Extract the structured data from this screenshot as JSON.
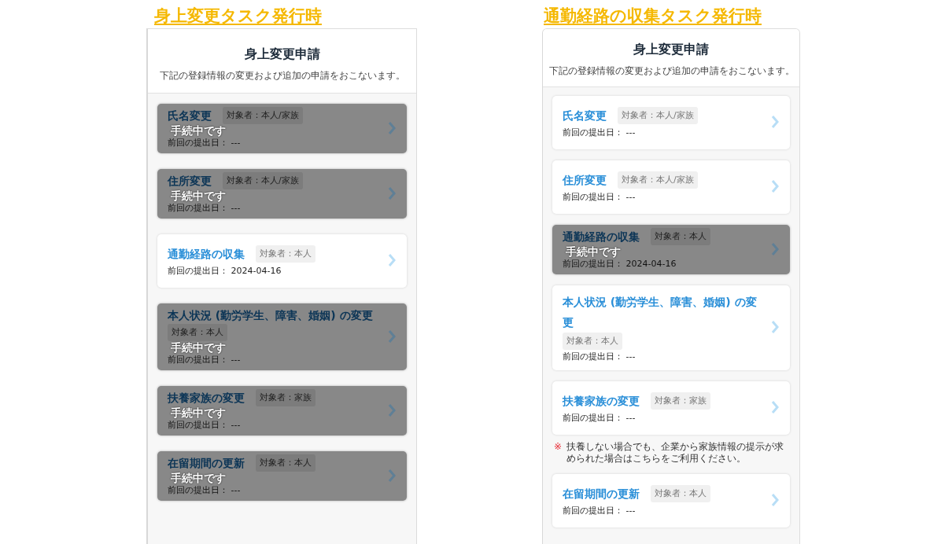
{
  "panels": [
    {
      "heading": "身上変更タスク発行時",
      "title": "身上変更申請",
      "description": "下記の登録情報の変更および追加の申請をおこないます。",
      "items": [
        {
          "kind": "card",
          "title": "氏名変更",
          "target": "対象者：本人/家族",
          "last_submitted": "前回の提出日： ---",
          "in_progress": true,
          "status_label": "手続中です"
        },
        {
          "kind": "card",
          "title": "住所変更",
          "target": "対象者：本人/家族",
          "last_submitted": "前回の提出日： ---",
          "in_progress": true,
          "status_label": "手続中です"
        },
        {
          "kind": "card",
          "title": "通勤経路の収集",
          "target": "対象者：本人",
          "last_submitted": "前回の提出日： 2024-04-16",
          "in_progress": false
        },
        {
          "kind": "card",
          "title": "本人状況 (勤労学生、障害、婚姻) の変更",
          "target": "対象者：本人",
          "last_submitted": "前回の提出日： ---",
          "in_progress": true,
          "status_label": "手続中です"
        },
        {
          "kind": "card",
          "title": "扶養家族の変更",
          "target": "対象者：家族",
          "last_submitted": "前回の提出日： ---",
          "in_progress": true,
          "status_label": "手続中です"
        },
        {
          "kind": "card",
          "title": "在留期間の更新",
          "target": "対象者：本人",
          "last_submitted": "前回の提出日： ---",
          "in_progress": true,
          "status_label": "手続中です"
        }
      ]
    },
    {
      "heading": "通勤経路の収集タスク発行時",
      "title": "身上変更申請",
      "description": "下記の登録情報の変更および追加の申請をおこないます。",
      "items": [
        {
          "kind": "card",
          "title": "氏名変更",
          "target": "対象者：本人/家族",
          "last_submitted": "前回の提出日： ---",
          "in_progress": false
        },
        {
          "kind": "card",
          "title": "住所変更",
          "target": "対象者：本人/家族",
          "last_submitted": "前回の提出日： ---",
          "in_progress": false
        },
        {
          "kind": "card",
          "title": "通勤経路の収集",
          "target": "対象者：本人",
          "last_submitted": "前回の提出日： 2024-04-16",
          "in_progress": true,
          "status_label": "手続中です"
        },
        {
          "kind": "card",
          "title": "本人状況 (勤労学生、障害、婚姻) の変更",
          "target": "対象者：本人",
          "last_submitted": "前回の提出日： ---",
          "in_progress": false
        },
        {
          "kind": "card",
          "title": "扶養家族の変更",
          "target": "対象者：家族",
          "last_submitted": "前回の提出日： ---",
          "in_progress": false
        },
        {
          "kind": "note",
          "mark": "※",
          "text": "扶養しない場合でも、企業から家族情報の提示が求められた場合はこちらをご利用ください。"
        },
        {
          "kind": "card",
          "title": "在留期間の更新",
          "target": "対象者：本人",
          "last_submitted": "前回の提出日： ---",
          "in_progress": false
        }
      ]
    }
  ]
}
